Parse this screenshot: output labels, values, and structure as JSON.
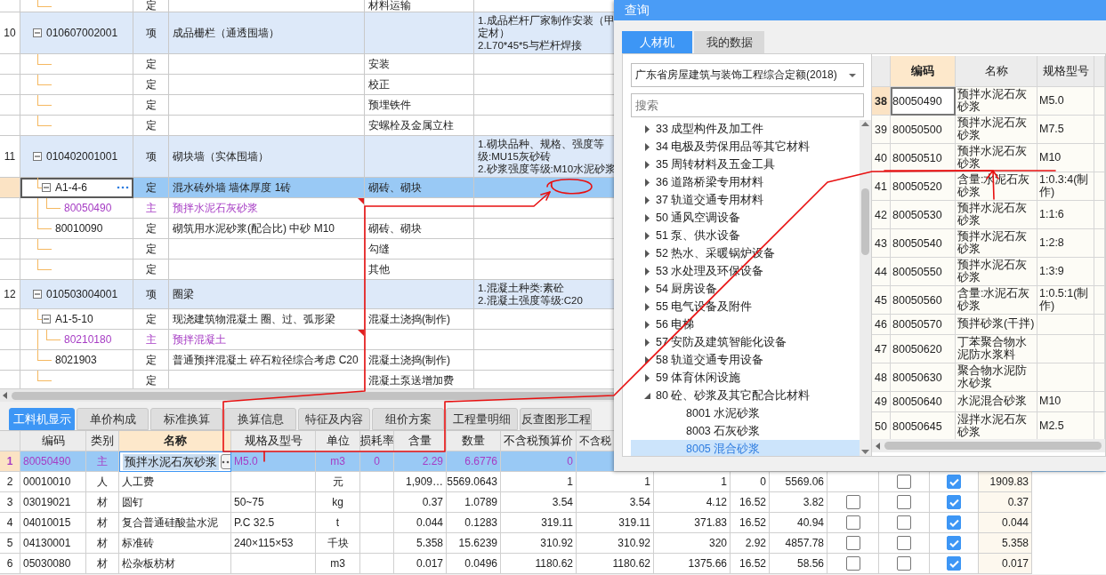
{
  "main_grid": {
    "rows": [
      {
        "kind": "quota",
        "type": "定",
        "work": "材料运输"
      },
      {
        "kind": "item",
        "num": "10",
        "code": "010607002001",
        "type": "项",
        "name": "成品栅栏（通透围墙）",
        "feature": [
          "1.成品栏杆厂家制作安装（甲",
          "定材）",
          "2.L70*45*5与栏杆焊接"
        ],
        "expanded": true,
        "selected": false,
        "children": [
          {
            "kind": "quota",
            "type": "定",
            "work": "安装",
            "selected": false
          },
          {
            "kind": "quota",
            "type": "定",
            "work": "校正",
            "selected": false
          },
          {
            "kind": "quota",
            "type": "定",
            "work": "预埋铁件",
            "selected": false
          },
          {
            "kind": "quota",
            "type": "定",
            "work": "安螺栓及金属立柱",
            "selected": false
          }
        ]
      },
      {
        "kind": "item",
        "num": "11",
        "code": "010402001001",
        "type": "项",
        "name": "砌块墙（实体围墙）",
        "feature": [
          "1.砌块品种、规格、强度等",
          "级:MU15灰砂砖",
          "2.砂浆强度等级:M10水泥砂浆"
        ],
        "expanded": true,
        "selected": false,
        "children": [
          {
            "kind": "quota",
            "code": "A1-4-6",
            "type": "定",
            "name": "混水砖外墙 墙体厚度 1砖",
            "work": "砌砖、砌块",
            "expanded": true,
            "selected": true,
            "children": [
              {
                "kind": "material",
                "code": "80050490",
                "type": "主",
                "name": "预拌水泥石灰砂浆",
                "selected": false
              }
            ]
          },
          {
            "kind": "quota",
            "code": "80010090",
            "type": "定",
            "name": "砌筑用水泥砂浆(配合比) 中砂 M10",
            "work": "砌砖、砌块",
            "selected": false
          },
          {
            "kind": "quota",
            "type": "定",
            "work": "勾缝",
            "selected": false
          },
          {
            "kind": "quota",
            "type": "定",
            "work": "其他",
            "selected": false
          }
        ]
      },
      {
        "kind": "item",
        "num": "12",
        "code": "010503004001",
        "type": "项",
        "name": "圈梁",
        "feature": [
          "1.混凝土种类:素砼",
          "2.混凝土强度等级:C20"
        ],
        "expanded": true,
        "selected": false,
        "children": [
          {
            "kind": "quota",
            "code": "A1-5-10",
            "type": "定",
            "name": "现浇建筑物混凝土 圈、过、弧形梁",
            "work": "混凝土浇捣(制作)",
            "expanded": true,
            "selected": false,
            "children": [
              {
                "kind": "material",
                "code": "80210180",
                "type": "主",
                "name": "预拌混凝土",
                "selected": false
              }
            ]
          },
          {
            "kind": "quota",
            "code": "8021903",
            "type": "定",
            "name": "普通预拌混凝土 碎石粒径综合考虑 C20",
            "work": "混凝土浇捣(制作)",
            "selected": false
          },
          {
            "kind": "quota",
            "type": "定",
            "work": "混凝土泵送增加费",
            "selected": false
          }
        ]
      }
    ]
  },
  "bottom_tabs": [
    {
      "label": "工料机显示",
      "selected": true
    },
    {
      "label": "单价构成",
      "selected": false
    },
    {
      "label": "标准换算",
      "selected": false
    },
    {
      "label": "换算信息",
      "selected": false
    },
    {
      "label": "特征及内容",
      "selected": false
    },
    {
      "label": "组价方案",
      "selected": false
    },
    {
      "label": "工程量明细",
      "selected": false
    },
    {
      "label": "反查图形工程",
      "selected": false
    }
  ],
  "bottom_table": {
    "columns": [
      "编码",
      "类别",
      "名称",
      "规格及型号",
      "单位",
      "损耗率",
      "含量",
      "数量",
      "不含税预算价",
      "不含税"
    ],
    "rows": [
      {
        "num": "1",
        "code": "80050490",
        "category": "主",
        "name": "预拌水泥石灰砂浆",
        "spec": "M5.0",
        "unit": "m3",
        "loss": "0",
        "content": "2.29",
        "quantity": "6.6776",
        "price": "0",
        "main": true,
        "selected": true
      },
      {
        "num": "2",
        "code": "00010010",
        "category": "人",
        "name": "人工费",
        "unit": "元",
        "content": "1,909…",
        "quantity": "5569.0643",
        "price": "1",
        "column_11": "1",
        "column_12": "1",
        "column_13": "0",
        "column_14": "5569.06",
        "check_2": false,
        "check_3": true,
        "column_18": "1909.83",
        "main": false,
        "selected": false
      },
      {
        "num": "3",
        "code": "03019021",
        "category": "材",
        "name": "圆钉",
        "spec": "50~75",
        "unit": "kg",
        "content": "0.37",
        "quantity": "1.0789",
        "price": "3.54",
        "column_11": "3.54",
        "column_12": "4.12",
        "column_13": "16.52",
        "column_14": "3.82",
        "check_1": false,
        "check_2": false,
        "check_3": true,
        "column_18": "0.37",
        "main": false,
        "selected": false
      },
      {
        "num": "4",
        "code": "04010015",
        "category": "材",
        "name": "复合普通硅酸盐水泥",
        "spec": "P.C 32.5",
        "unit": "t",
        "content": "0.044",
        "quantity": "0.1283",
        "price": "319.11",
        "column_11": "319.11",
        "column_12": "371.83",
        "column_13": "16.52",
        "column_14": "40.94",
        "check_1": false,
        "check_2": false,
        "check_3": true,
        "column_18": "0.044",
        "main": false,
        "selected": false
      },
      {
        "num": "5",
        "code": "04130001",
        "category": "材",
        "name": "标准砖",
        "spec": "240×115×53",
        "unit": "千块",
        "content": "5.358",
        "quantity": "15.6239",
        "price": "310.92",
        "column_11": "310.92",
        "column_12": "320",
        "column_13": "2.92",
        "column_14": "4857.78",
        "check_1": false,
        "check_2": false,
        "check_3": true,
        "column_18": "5.358",
        "main": false,
        "selected": false
      },
      {
        "num": "6",
        "code": "05030080",
        "category": "材",
        "name": "松杂板枋材",
        "unit": "m3",
        "content": "0.017",
        "quantity": "0.0496",
        "price": "1180.62",
        "column_11": "1180.62",
        "column_12": "1375.66",
        "column_13": "16.52",
        "column_14": "58.56",
        "check_1": false,
        "check_2": false,
        "check_3": true,
        "column_18": "0.017",
        "main": false,
        "selected": false
      }
    ]
  },
  "dialog": {
    "title": "查询",
    "tabs": [
      {
        "label": "人材机",
        "selected": true
      },
      {
        "label": "我的数据",
        "selected": false
      }
    ],
    "library": "广东省房屋建筑与装饰工程综合定额(2018)",
    "search": {
      "placeholder": "搜索"
    },
    "categories": [
      {
        "label": "33 成型构件及加工件",
        "expanded": false,
        "selected": false
      },
      {
        "label": "34 电极及劳保用品等其它材料",
        "expanded": false,
        "selected": false
      },
      {
        "label": "35 周转材料及五金工具",
        "expanded": false,
        "selected": false
      },
      {
        "label": "36 道路桥梁专用材料",
        "expanded": false,
        "selected": false
      },
      {
        "label": "37 轨道交通专用材料",
        "expanded": false,
        "selected": false
      },
      {
        "label": "50 通风空调设备",
        "expanded": false,
        "selected": false
      },
      {
        "label": "51 泵、供水设备",
        "expanded": false,
        "selected": false
      },
      {
        "label": "52 热水、采暖锅炉设备",
        "expanded": false,
        "selected": false
      },
      {
        "label": "53 水处理及环保设备",
        "expanded": false,
        "selected": false
      },
      {
        "label": "54 厨房设备",
        "expanded": false,
        "selected": false
      },
      {
        "label": "55 电气设备及附件",
        "expanded": false,
        "selected": false
      },
      {
        "label": "56 电梯",
        "expanded": false,
        "selected": false
      },
      {
        "label": "57 安防及建筑智能化设备",
        "expanded": false,
        "selected": false
      },
      {
        "label": "58 轨道交通专用设备",
        "expanded": false,
        "selected": false
      },
      {
        "label": "59 体育休闲设施",
        "expanded": false,
        "selected": false
      },
      {
        "label": "80 砼、砂浆及其它配合比材料",
        "expanded": true,
        "selected": false,
        "children": [
          {
            "label": "8001 水泥砂浆",
            "selected": false
          },
          {
            "label": "8003 石灰砂浆",
            "selected": false
          },
          {
            "label": "8005 混合砂浆",
            "selected": true
          }
        ]
      }
    ],
    "grid": {
      "columns": [
        "编码",
        "名称",
        "规格型号"
      ],
      "rows": [
        {
          "num": "38",
          "code": "80050490",
          "name": "预拌水泥石灰砂浆",
          "spec": "M5.0",
          "selected": true
        },
        {
          "num": "39",
          "code": "80050500",
          "name": "预拌水泥石灰砂浆",
          "spec": "M7.5",
          "selected": false
        },
        {
          "num": "40",
          "code": "80050510",
          "name": "预拌水泥石灰砂浆",
          "spec": "M10",
          "selected": false
        },
        {
          "num": "41",
          "code": "80050520",
          "name": "含量:水泥石灰砂浆",
          "spec": "1:0.3:4(制作)",
          "selected": false
        },
        {
          "num": "42",
          "code": "80050530",
          "name": "预拌水泥石灰砂浆",
          "spec": "1:1:6",
          "selected": false
        },
        {
          "num": "43",
          "code": "80050540",
          "name": "预拌水泥石灰砂浆",
          "spec": "1:2:8",
          "selected": false
        },
        {
          "num": "44",
          "code": "80050550",
          "name": "预拌水泥石灰砂浆",
          "spec": "1:3:9",
          "selected": false
        },
        {
          "num": "45",
          "code": "80050560",
          "name": "含量:水泥石灰砂浆",
          "spec": "1:0.5:1(制作)",
          "selected": false
        },
        {
          "num": "46",
          "code": "80050570",
          "name": "预拌砂浆(干拌)",
          "selected": false
        },
        {
          "num": "47",
          "code": "80050620",
          "name": "丁苯聚合物水泥防水浆料",
          "selected": false
        },
        {
          "num": "48",
          "code": "80050630",
          "name": "聚合物水泥防水砂浆",
          "selected": false
        },
        {
          "num": "49",
          "code": "80050640",
          "name": "水泥混合砂浆",
          "spec": "M10",
          "selected": false
        },
        {
          "num": "50",
          "code": "80050645",
          "name": "湿拌水泥石灰砂浆",
          "spec": "M2.5",
          "selected": false
        }
      ]
    }
  }
}
